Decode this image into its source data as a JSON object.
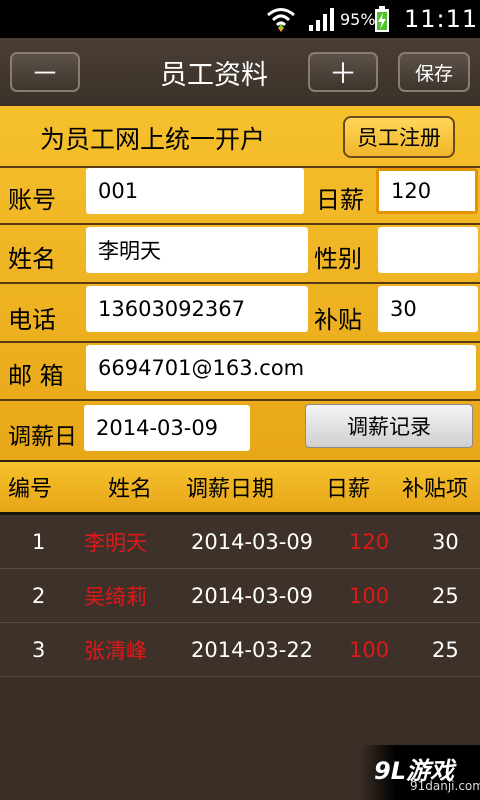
{
  "status_bar": {
    "battery_percent": "95%",
    "time": "11:11"
  },
  "header": {
    "minus_label": "－",
    "title": "员工资料",
    "plus_label": "＋",
    "save_label": "保存"
  },
  "form": {
    "register_prompt": "为员工网上统一开户",
    "register_button": "员工注册",
    "account": {
      "label": "账号",
      "value": "001"
    },
    "daily_salary": {
      "label": "日薪",
      "value": "120"
    },
    "name": {
      "label": "姓名",
      "value": "李明天"
    },
    "gender": {
      "label": "性别",
      "value": ""
    },
    "phone": {
      "label": "电话",
      "value": "13603092367"
    },
    "allowance": {
      "label": "补贴",
      "value": "30"
    },
    "email": {
      "label": "邮 箱",
      "value": "6694701@163.com"
    },
    "adjust_date": {
      "label": "调薪日",
      "value": "2014-03-09"
    },
    "history_button": "调薪记录"
  },
  "table": {
    "headers": [
      "编号",
      "姓名",
      "调薪日期",
      "日薪",
      "补贴项"
    ],
    "rows": [
      {
        "no": "1",
        "name": "李明天",
        "date": "2014-03-09",
        "salary": "120",
        "allowance": "30"
      },
      {
        "no": "2",
        "name": "吴绮莉",
        "date": "2014-03-09",
        "salary": "100",
        "allowance": "25"
      },
      {
        "no": "3",
        "name": "张清峰",
        "date": "2014-03-22",
        "salary": "100",
        "allowance": "25"
      }
    ]
  },
  "watermark": {
    "logo": "9L游戏",
    "url": "91danji.com"
  },
  "colors": {
    "panel_yellow": "#f6c02d",
    "background_brown": "#3e3129",
    "accent_red": "#e01818",
    "focus_orange": "#e59400"
  }
}
